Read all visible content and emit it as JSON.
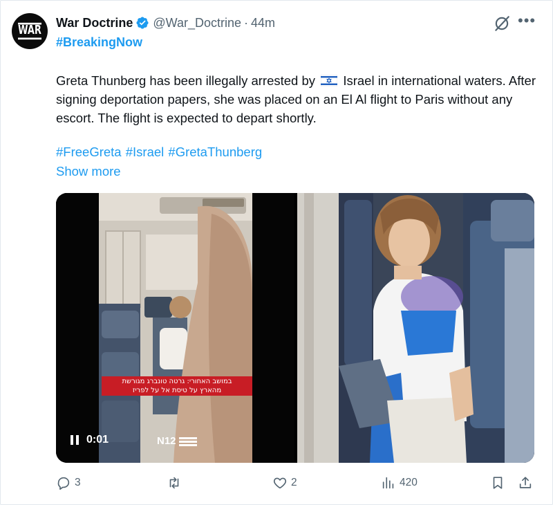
{
  "author": {
    "display_name": "War Doctrine",
    "handle": "@War_Doctrine",
    "separator": "·",
    "time_ago": "44m",
    "avatar_text": "WAR",
    "verified": true
  },
  "post": {
    "breaking_tag": "#BreakingNow",
    "text_before_flag": "Greta Thunberg has been illegally arrested by",
    "flag_icon": "israel-flag-icon",
    "text_after_flag": "Israel in international waters. After signing deportation papers, she was placed on an El Al flight to Paris without any escort. The flight is expected to depart shortly.",
    "hashtags": "#FreeGreta #Israel #GretaThunberg",
    "show_more": "Show more"
  },
  "media": {
    "video_caption_line1": "במושב האחורי: גרטה טונברג מגורשת",
    "video_caption_line2": "מהארץ על טיסת אל על לפריז",
    "video_time": "0:01",
    "channel_logo": "N12"
  },
  "actions": {
    "replies": "3",
    "reposts": "",
    "likes": "2",
    "views": "420"
  },
  "colors": {
    "accent": "#1d9bf0",
    "secondary_text": "#536471",
    "caption_red": "#c81d25"
  }
}
